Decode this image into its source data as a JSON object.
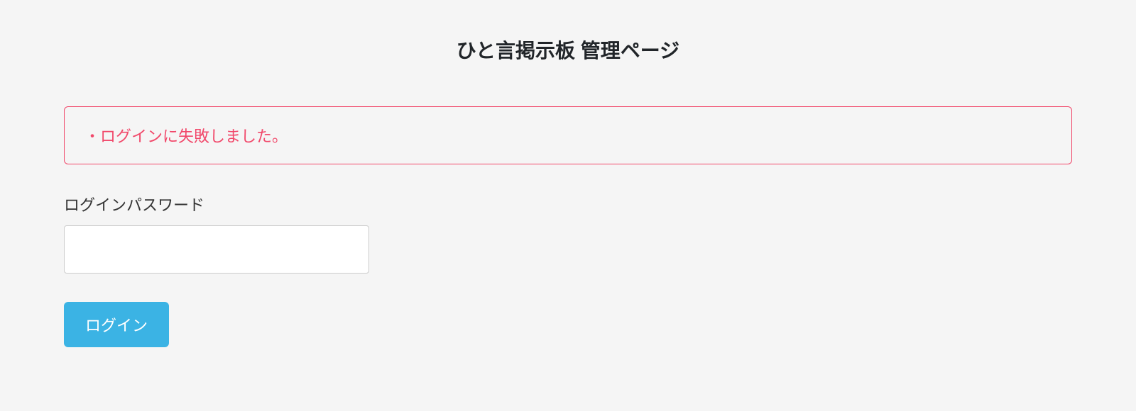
{
  "header": {
    "title": "ひと言掲示板 管理ページ"
  },
  "error": {
    "messages": [
      "・ログインに失敗しました。"
    ]
  },
  "form": {
    "password_label": "ログインパスワード",
    "password_value": "",
    "login_button_label": "ログイン"
  }
}
